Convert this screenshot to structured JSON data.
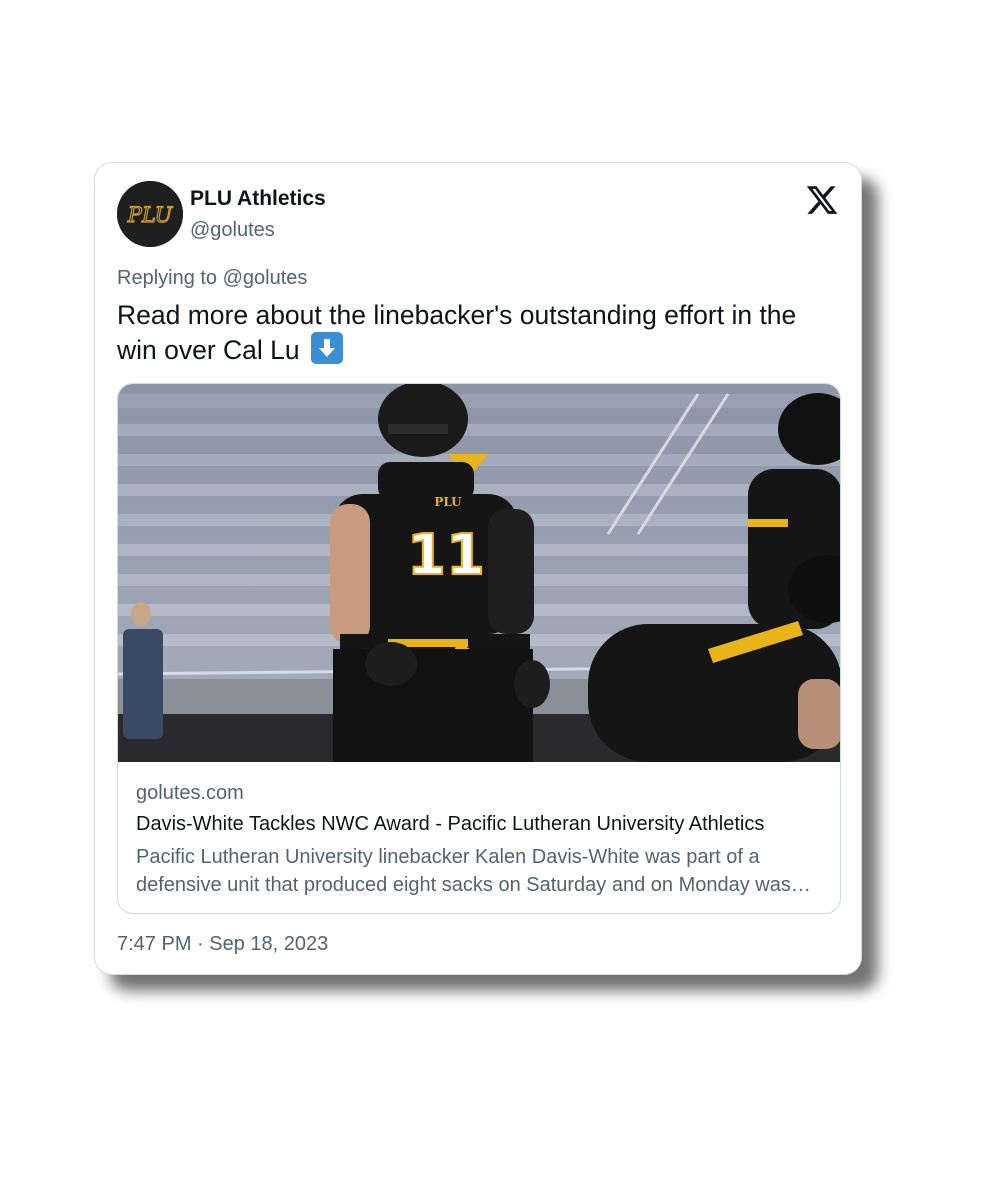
{
  "tweet": {
    "author": {
      "name": "PLU Athletics",
      "handle": "@golutes",
      "avatar_monogram": "PLU",
      "avatar_bg": "#1f1f1f",
      "avatar_fg": "#c99a2e"
    },
    "platform_icon": "x-logo-icon",
    "reply": {
      "prefix": "Replying to ",
      "mention": "@golutes"
    },
    "text": "Read more about the linebacker's outstanding effort in the win over Cal Lu",
    "emoji": "down-arrow-button-emoji",
    "link_card": {
      "image": "football-linebacker-photo",
      "domain": "golutes.com",
      "title": "Davis-White Tackles NWC Award - Pacific Lutheran University Athletics",
      "description": "Pacific Lutheran University linebacker Kalen Davis-White was part of a defensive unit that produced eight sacks on Saturday and on Monday was named NWC Defensive Player of the Week.",
      "jersey_text": "PLU",
      "jersey_number": "11"
    },
    "timestamp": "7:47 PM · Sep 18, 2023"
  },
  "colors": {
    "text_primary": "#0f1419",
    "text_secondary": "#536471",
    "border": "#cfd9de",
    "jersey_gold": "#e8b417",
    "jersey_black": "#151515",
    "emoji_blue": "#3b8ed3"
  }
}
